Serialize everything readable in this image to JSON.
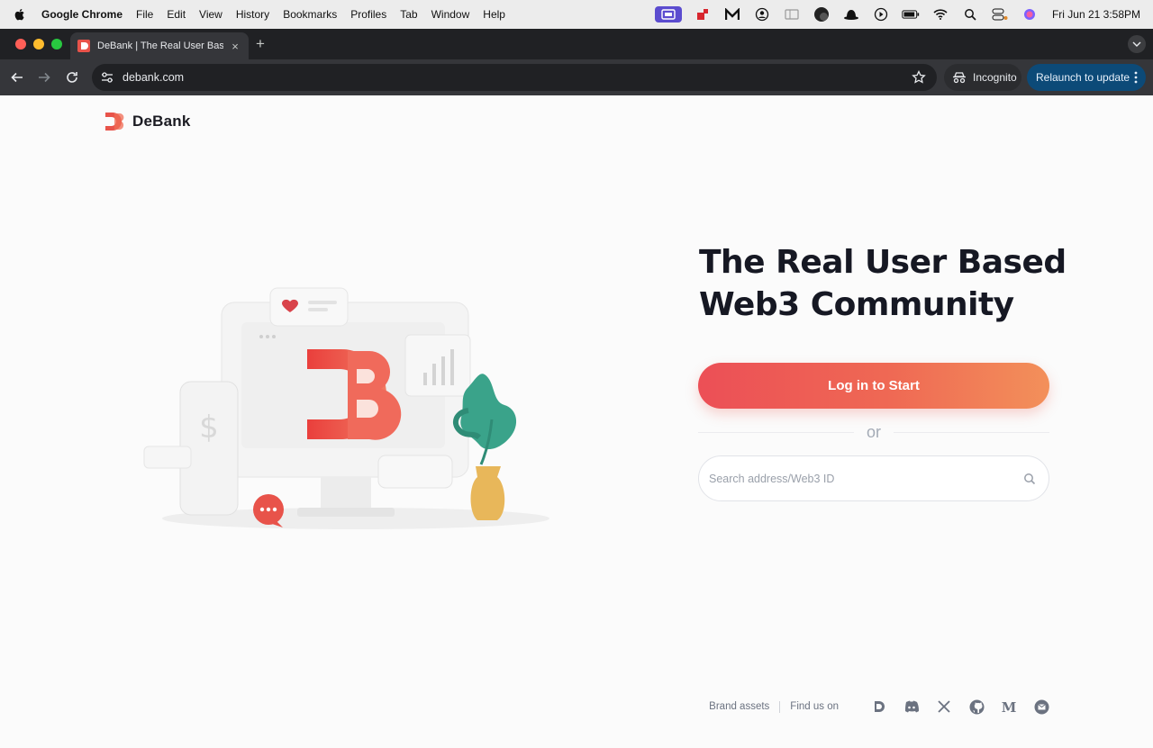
{
  "menubar": {
    "app_name": "Google Chrome",
    "items": [
      "File",
      "Edit",
      "View",
      "History",
      "Bookmarks",
      "Profiles",
      "Tab",
      "Window",
      "Help"
    ],
    "clock": "Fri Jun 21  3:58PM"
  },
  "browser": {
    "tab_title": "DeBank | The Real User Based",
    "new_tab_symbol": "+",
    "close_symbol": "×",
    "url": "debank.com",
    "incognito_label": "Incognito",
    "relaunch_label": "Relaunch to update"
  },
  "page": {
    "logo_name": "DeBank",
    "hero_title_line1": "The Real User Based",
    "hero_title_line2": "Web3 Community",
    "login_button": "Log in to Start",
    "or_text": "or",
    "search_placeholder": "Search address/Web3 ID",
    "brand_colors": {
      "primary": "#ec4f56",
      "gradient_end": "#f3905a",
      "plant": "#3aa38a",
      "vase": "#e8b75a"
    },
    "illustration_symbols": {
      "dollar": "$",
      "brand_letter": "B"
    }
  },
  "footer": {
    "brand_assets": "Brand assets",
    "find_us_on": "Find us on",
    "socials": [
      "debank-icon",
      "discord-icon",
      "x-icon",
      "github-icon",
      "medium-icon",
      "email-icon"
    ]
  }
}
